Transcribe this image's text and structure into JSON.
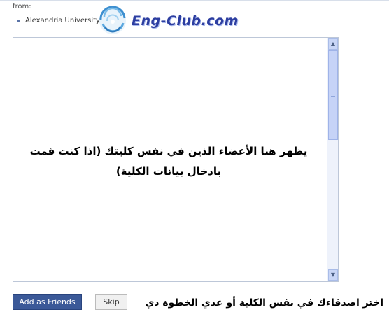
{
  "header": {
    "from_label": "from:",
    "school_name": "Alexandria University"
  },
  "logo": {
    "text": "Eng-Club.com"
  },
  "friends_box": {
    "message": "يظهر هنا الأعضاء الذين في نفس كليتك (اذا كنت قمت بادخال بيانات الكلية)",
    "scroll_up_glyph": "▲",
    "scroll_down_glyph": "▼"
  },
  "actions": {
    "add_label": "Add as Friends",
    "skip_label": "Skip"
  },
  "instruction": "اختر اصدقاءك في نفس الكلية أو عدي الخطوة دي",
  "colors": {
    "button_primary": "#3b5998",
    "logo_blue": "#2d3ea0",
    "scrollbar": "#c6d3f7"
  }
}
